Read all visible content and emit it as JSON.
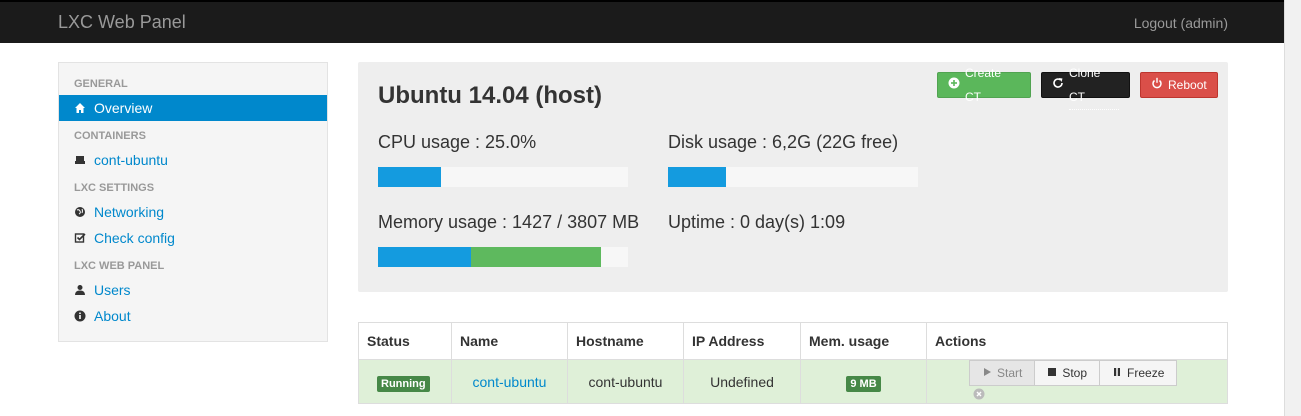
{
  "navbar": {
    "brand": "LXC Web Panel",
    "logout": "Logout (admin)"
  },
  "sidebar": {
    "sections": [
      {
        "header": "General",
        "items": [
          {
            "label": "Overview",
            "icon": "home-icon",
            "active": true
          }
        ]
      },
      {
        "header": "Containers",
        "items": [
          {
            "label": "cont-ubuntu",
            "icon": "drive-icon"
          }
        ]
      },
      {
        "header": "LXC Settings",
        "items": [
          {
            "label": "Networking",
            "icon": "globe-icon"
          },
          {
            "label": "Check config",
            "icon": "check-square-icon"
          }
        ]
      },
      {
        "header": "LXC Web Panel",
        "items": [
          {
            "label": "Users",
            "icon": "user-icon"
          },
          {
            "label": "About",
            "icon": "info-icon"
          }
        ]
      }
    ]
  },
  "host": {
    "title": "Ubuntu 14.04 (host)",
    "cpu_label": "CPU usage : 25.0%",
    "cpu_fraction": 0.25,
    "disk_label": "Disk usage : 6,2G (22G free)",
    "disk_fraction": 0.23,
    "mem_label": "Memory usage : 1427 / 3807 MB",
    "mem_used_fraction": 0.37,
    "mem_cached_fraction": 0.52,
    "uptime_label": "Uptime : 0 day(s) 1:09"
  },
  "actions": {
    "create": "Create CT",
    "clone": "Clone CT",
    "reboot": "Reboot"
  },
  "table": {
    "headers": [
      "Status",
      "Name",
      "Hostname",
      "IP Address",
      "Mem. usage",
      "Actions"
    ],
    "rows": [
      {
        "status": "Running",
        "name": "cont-ubuntu",
        "hostname": "cont-ubuntu",
        "ip": "Undefined",
        "mem": "9 MB",
        "buttons": {
          "start": "Start",
          "stop": "Stop",
          "freeze": "Freeze"
        }
      }
    ]
  },
  "colors": {
    "accent": "#0088cc",
    "success": "#5bb75b",
    "danger": "#da4f49",
    "progress": "#149bdf",
    "progress_green": "#5eb95e"
  }
}
